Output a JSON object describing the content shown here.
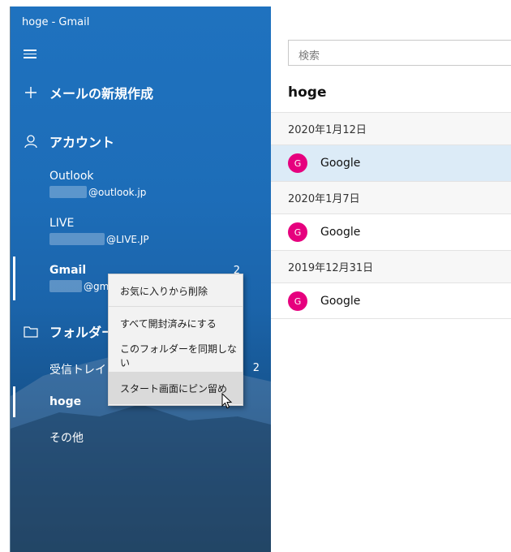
{
  "app": {
    "title": "hoge - Gmail"
  },
  "nav": {
    "menu_icon": "hamburger-icon",
    "compose": {
      "label": "メールの新規作成",
      "icon": "plus-icon"
    },
    "accounts": {
      "label": "アカウント",
      "icon": "person-icon",
      "items": [
        {
          "name": "Outlook",
          "email": "@outlook.jp",
          "count": ""
        },
        {
          "name": "LIVE",
          "email": "@LIVE.JP",
          "count": ""
        },
        {
          "name": "Gmail",
          "email": "@gm",
          "count": "2"
        }
      ]
    },
    "folders": {
      "label": "フォルダー",
      "icon": "folder-icon",
      "items": [
        {
          "name": "受信トレイ",
          "count": "2"
        },
        {
          "name": "hoge",
          "count": ""
        },
        {
          "name": "その他",
          "count": ""
        }
      ]
    }
  },
  "context_menu": {
    "items": [
      "お気に入りから削除",
      "すべて開封済みにする",
      "このフォルダーを同期しない",
      "スタート画面にピン留め"
    ]
  },
  "main": {
    "search_placeholder": "検索",
    "folder_title": "hoge",
    "groups": [
      {
        "date": "2020年1月12日",
        "messages": [
          {
            "avatar": "G",
            "sender": "Google"
          }
        ]
      },
      {
        "date": "2020年1月7日",
        "messages": [
          {
            "avatar": "G",
            "sender": "Google"
          }
        ]
      },
      {
        "date": "2019年12月31日",
        "messages": [
          {
            "avatar": "G",
            "sender": "Google"
          }
        ]
      }
    ]
  },
  "colors": {
    "nav_background": "#1d6db8",
    "avatar": "#e6007e",
    "selected_row": "#dcebf7"
  }
}
